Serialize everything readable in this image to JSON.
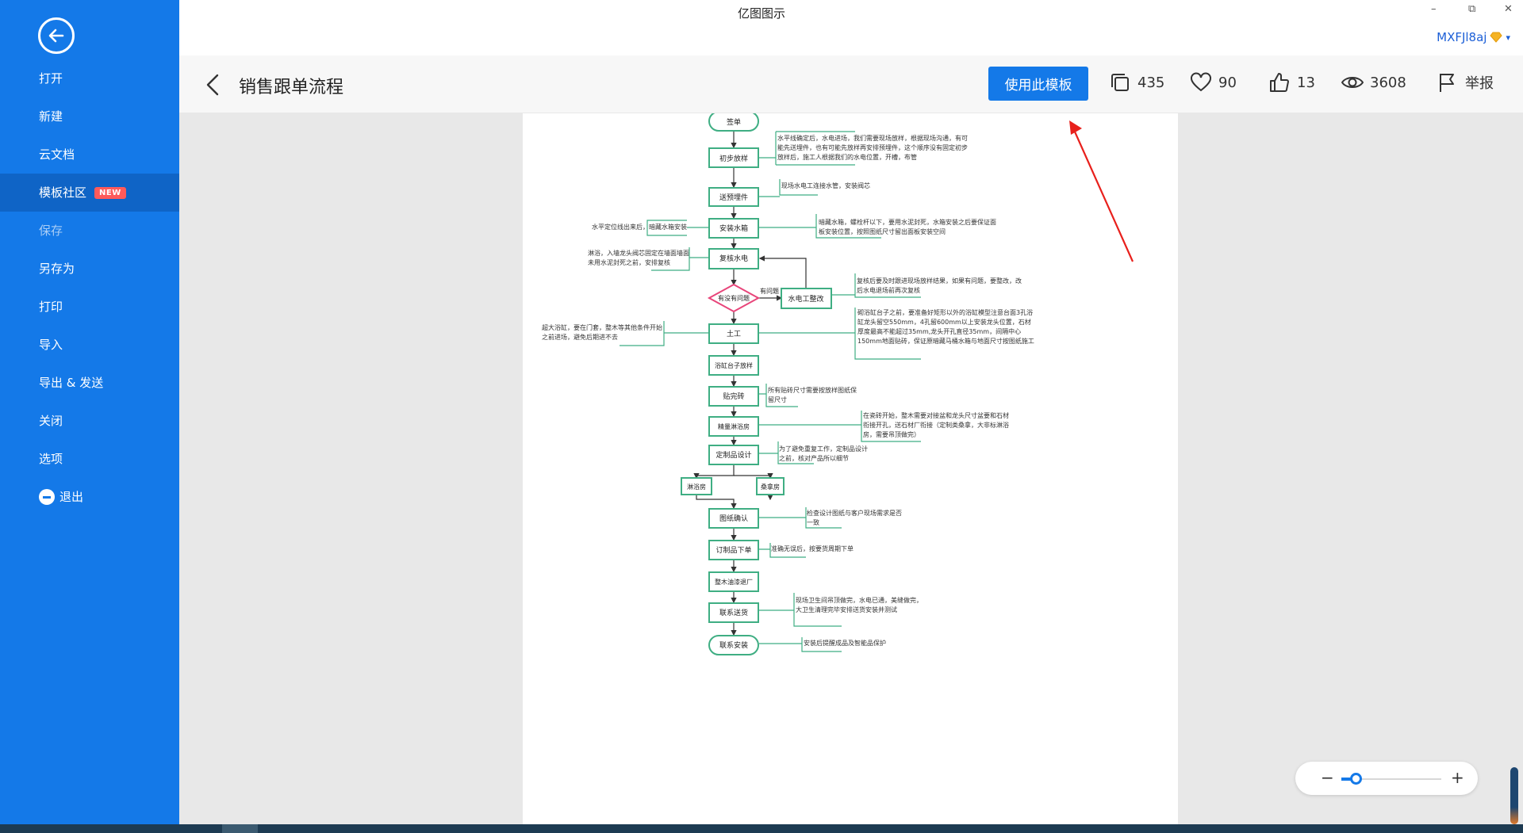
{
  "window": {
    "title": "亿图图示",
    "minimize": "–",
    "restore": "⧉",
    "close": "✕"
  },
  "user": {
    "name": "MXFJl8aj",
    "caret": "▾"
  },
  "sidebar": {
    "items": [
      {
        "label": "打开"
      },
      {
        "label": "新建"
      },
      {
        "label": "云文档"
      },
      {
        "label": "模板社区",
        "badge": "NEW",
        "active": true
      },
      {
        "label": "保存",
        "dim": true
      },
      {
        "label": "另存为"
      },
      {
        "label": "打印"
      },
      {
        "label": "导入"
      },
      {
        "label": "导出 & 发送"
      },
      {
        "label": "关闭"
      },
      {
        "label": "选项"
      },
      {
        "label": "退出"
      }
    ]
  },
  "header": {
    "title": "销售跟单流程",
    "use_button": "使用此模板",
    "stats": {
      "copies": "435",
      "favorites": "90",
      "likes": "13",
      "views": "3608",
      "report": "举报"
    }
  },
  "zoom": {
    "minus": "−",
    "plus": "+",
    "level": 0.14
  },
  "colors": {
    "accent": "#1479e8",
    "flow_green": "#3fae83",
    "decision_pink": "#e8457a",
    "arrow_red": "#e8201c"
  },
  "flowchart": {
    "steps": [
      "签单",
      "初步放样",
      "送预埋件",
      "安装水箱",
      "复核水电",
      "有没有问题",
      "水电工整改",
      "土工",
      "浴缸台子放样",
      "贴完砖",
      "精量淋浴房",
      "定制品设计",
      "淋浴房",
      "桑拿房",
      "图纸确认",
      "订制品下单",
      "整木油漆退厂",
      "联系送货",
      "联系安装"
    ],
    "decision_label": "有问题",
    "notes": [
      "水平线确定后，水电进场，我们需要现场放样，根据现场沟通，有可能先送埋件，也有可能先放样再安排预埋件，这个顺序没有固定初步放样后，施工人根据我们的水电位置，开槽，布管",
      "现场水电工连接水管，安装阀芯",
      "暗藏水箱，螺栓杆以下，要用水泥封死，水箱安装之后要保证面板安装位置，按照图纸尺寸留出面板安装空间",
      "水平定位线出来后，暗藏水箱安装",
      "淋浴，入墙龙头阀芯固定在墙面墙面未用水泥封死之前，安排复核",
      "复核后要及时跟进现场放样结果，如果有问题，要整改，改后水电退场前再次复核",
      "砌浴缸台子之前，要准备好矩形以外的浴缸模型注意台面3孔浴缸龙头留空550mm，4孔留600mm以上安装龙头位置，石材厚度最高不能超过35mm,龙头开孔直径35mm，间隔中心150mm地面贴砖，保证原暗藏马桶水箱与地面尺寸按图纸施工",
      "超大浴缸，要在门套，整木等其他条件开始之前进场，避免后期进不去",
      "所有贴砖尺寸需要按放样图纸保留尺寸",
      "在瓷砖开始，整木需要对接盆和龙头尺寸盆要和石材衔接开孔，送石材厂衔接（定制类桑拿，大非标淋浴房，需要吊顶做完）",
      "为了避免重复工作，定制品设计之前，核对产品所以细节",
      "检查设计图纸与客户现场需求是否一致",
      "准确无误后，按要货周期下单",
      "现场卫生间吊顶做完，水电已通，美缝做完，大卫生清理完毕安排送货安装并测试",
      "安装后提醒成品及智能品保护"
    ]
  }
}
